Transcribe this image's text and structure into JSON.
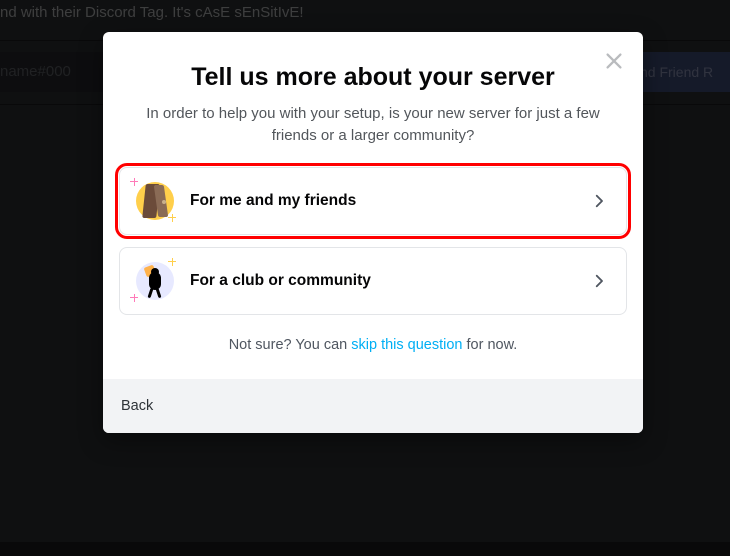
{
  "background": {
    "hint_text": "nd with their Discord Tag. It's cAsE sEnSitIvE!",
    "input_placeholder": "name#000",
    "friend_button": "nd Friend R"
  },
  "modal": {
    "title": "Tell us more about your server",
    "subtitle": "In order to help you with your setup, is your new server for just a few friends or a larger community?",
    "options": [
      {
        "label": "For me and my friends"
      },
      {
        "label": "For a club or community"
      }
    ],
    "skip": {
      "prefix": "Not sure? You can ",
      "link": "skip this question",
      "suffix": " for now."
    },
    "back": "Back"
  }
}
